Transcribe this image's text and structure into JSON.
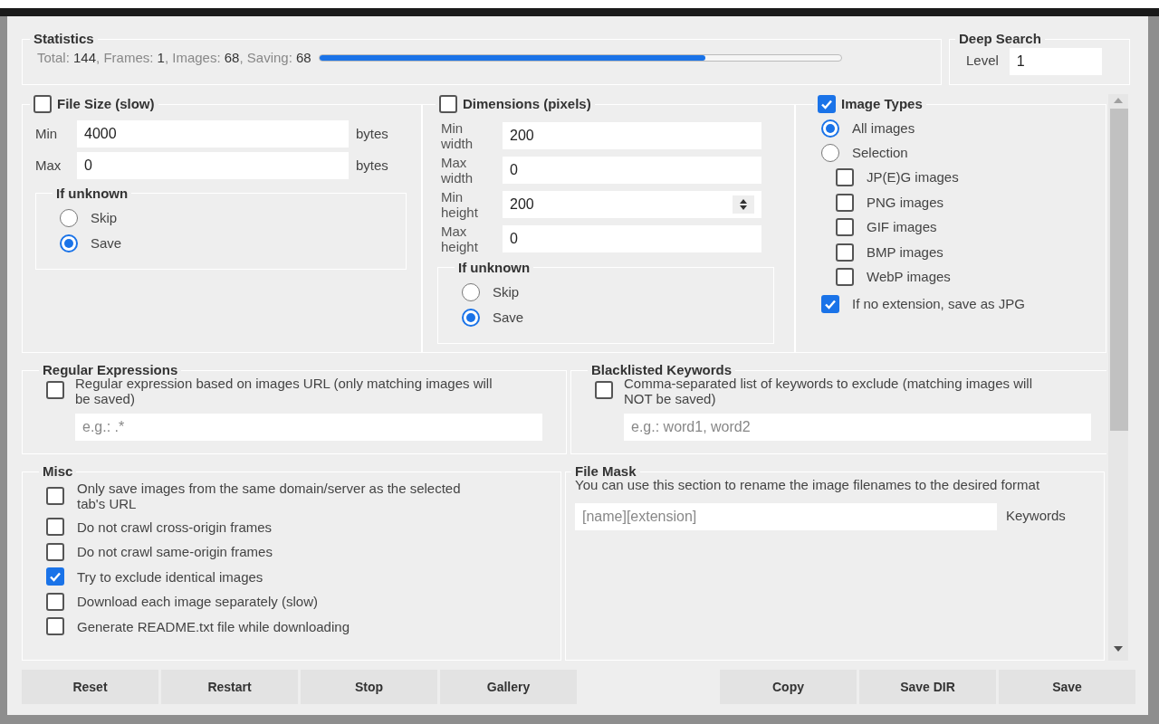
{
  "statistics": {
    "title": "Statistics",
    "items": [
      {
        "label": "Total:",
        "value": "144"
      },
      {
        "label": ", Frames:",
        "value": "1"
      },
      {
        "label": ", Images:",
        "value": "68"
      },
      {
        "label": ", Saving:",
        "value": "68"
      }
    ],
    "progress": {
      "level": 0.74
    }
  },
  "deep_search": {
    "title": "Deep Search",
    "label": "Level",
    "value": "1"
  },
  "file_size": {
    "title": "File Size (slow)",
    "checked": false,
    "fields": [
      {
        "label": "Min",
        "value": "4000",
        "unit": "bytes"
      },
      {
        "label": "Max",
        "value": "0",
        "unit": "bytes"
      }
    ],
    "if_unknown": {
      "title": "If unknown",
      "options": [
        {
          "label": "Skip",
          "selected": false
        },
        {
          "label": "Save",
          "selected": true
        }
      ]
    }
  },
  "dimensions": {
    "title": "Dimensions (pixels)",
    "checked": false,
    "fields": [
      {
        "label": "Min width",
        "value": "200",
        "spinner": false
      },
      {
        "label": "Max width",
        "value": "0",
        "spinner": false
      },
      {
        "label": "Min height",
        "value": "200",
        "spinner": true
      },
      {
        "label": "Max height",
        "value": "0",
        "spinner": false
      }
    ],
    "if_unknown": {
      "title": "If unknown",
      "options": [
        {
          "label": "Skip",
          "selected": false
        },
        {
          "label": "Save",
          "selected": true
        }
      ]
    }
  },
  "image_types": {
    "title": "Image Types",
    "checked": true,
    "modes": [
      {
        "label": "All images",
        "selected": true
      },
      {
        "label": "Selection",
        "selected": false
      }
    ],
    "types": [
      {
        "label": "JP(E)G images",
        "checked": false
      },
      {
        "label": "PNG images",
        "checked": false
      },
      {
        "label": "GIF images",
        "checked": false
      },
      {
        "label": "BMP images",
        "checked": false
      },
      {
        "label": "WebP images",
        "checked": false
      }
    ],
    "no_extension": {
      "label": "If no extension, save as JPG",
      "checked": true
    }
  },
  "regular_expressions": {
    "title": "Regular Expressions",
    "label": "Regular expression based on images URL (only matching images will be saved)",
    "checked": false,
    "placeholder": "e.g.: .*"
  },
  "blacklisted_keywords": {
    "title": "Blacklisted Keywords",
    "label": "Comma-separated list of keywords to exclude (matching images will NOT be saved)",
    "checked": false,
    "placeholder": "e.g.: word1, word2"
  },
  "misc": {
    "title": "Misc",
    "options": [
      {
        "label": "Only save images from the same domain/server as the selected tab's URL",
        "checked": false
      },
      {
        "label": "Do not crawl cross-origin frames",
        "checked": false
      },
      {
        "label": "Do not crawl same-origin frames",
        "checked": false
      },
      {
        "label": "Try to exclude identical images",
        "checked": true
      },
      {
        "label": "Download each image separately (slow)",
        "checked": false
      },
      {
        "label": "Generate README.txt file while downloading",
        "checked": false
      }
    ]
  },
  "file_mask": {
    "title": "File Mask",
    "description": "You can use this section to rename the image filenames to the desired format",
    "placeholder": "[name][extension]",
    "button": "Keywords"
  },
  "buttons_left": [
    "Reset",
    "Restart",
    "Stop",
    "Gallery"
  ],
  "buttons_right": [
    "Copy",
    "Save DIR",
    "Save"
  ]
}
